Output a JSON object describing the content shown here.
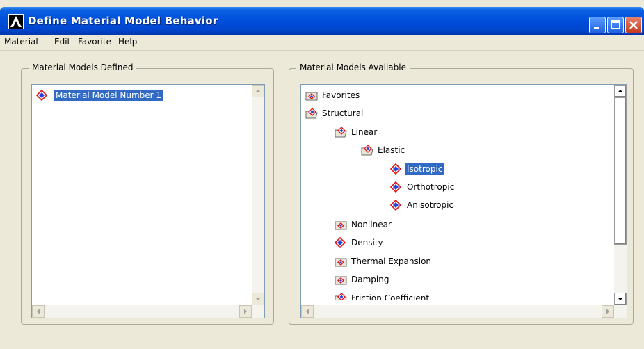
{
  "window": {
    "title": "Define Material Model Behavior",
    "colors": {
      "titlebar": "#0050dd",
      "selection": "#316ac5",
      "close": "#c5391b"
    }
  },
  "menu": [
    "Material",
    "Edit",
    "Favorite",
    "Help"
  ],
  "defined": {
    "label": "Material Models Defined",
    "items": [
      {
        "label": "Material Model Number 1",
        "icon": "material-model-icon",
        "selected": true
      }
    ]
  },
  "available": {
    "label": "Material Models Available",
    "tree": [
      {
        "label": "Favorites",
        "icon": "folder-closed-icon",
        "level": 0
      },
      {
        "label": "Structural",
        "icon": "folder-open-icon",
        "level": 0
      },
      {
        "label": "Linear",
        "icon": "folder-open-icon",
        "level": 1
      },
      {
        "label": "Elastic",
        "icon": "folder-open-icon",
        "level": 2
      },
      {
        "label": "Isotropic",
        "icon": "material-model-icon",
        "level": 3,
        "selected": true
      },
      {
        "label": "Orthotropic",
        "icon": "material-model-icon",
        "level": 3
      },
      {
        "label": "Anisotropic",
        "icon": "material-model-icon",
        "level": 3
      },
      {
        "label": "Nonlinear",
        "icon": "folder-closed-icon",
        "level": 1
      },
      {
        "label": "Density",
        "icon": "material-model-icon",
        "level": 1
      },
      {
        "label": "Thermal Expansion",
        "icon": "folder-closed-icon",
        "level": 1
      },
      {
        "label": "Damping",
        "icon": "folder-closed-icon",
        "level": 1
      },
      {
        "label": "Friction Coefficient",
        "icon": "folder-open-icon",
        "level": 1
      }
    ]
  }
}
